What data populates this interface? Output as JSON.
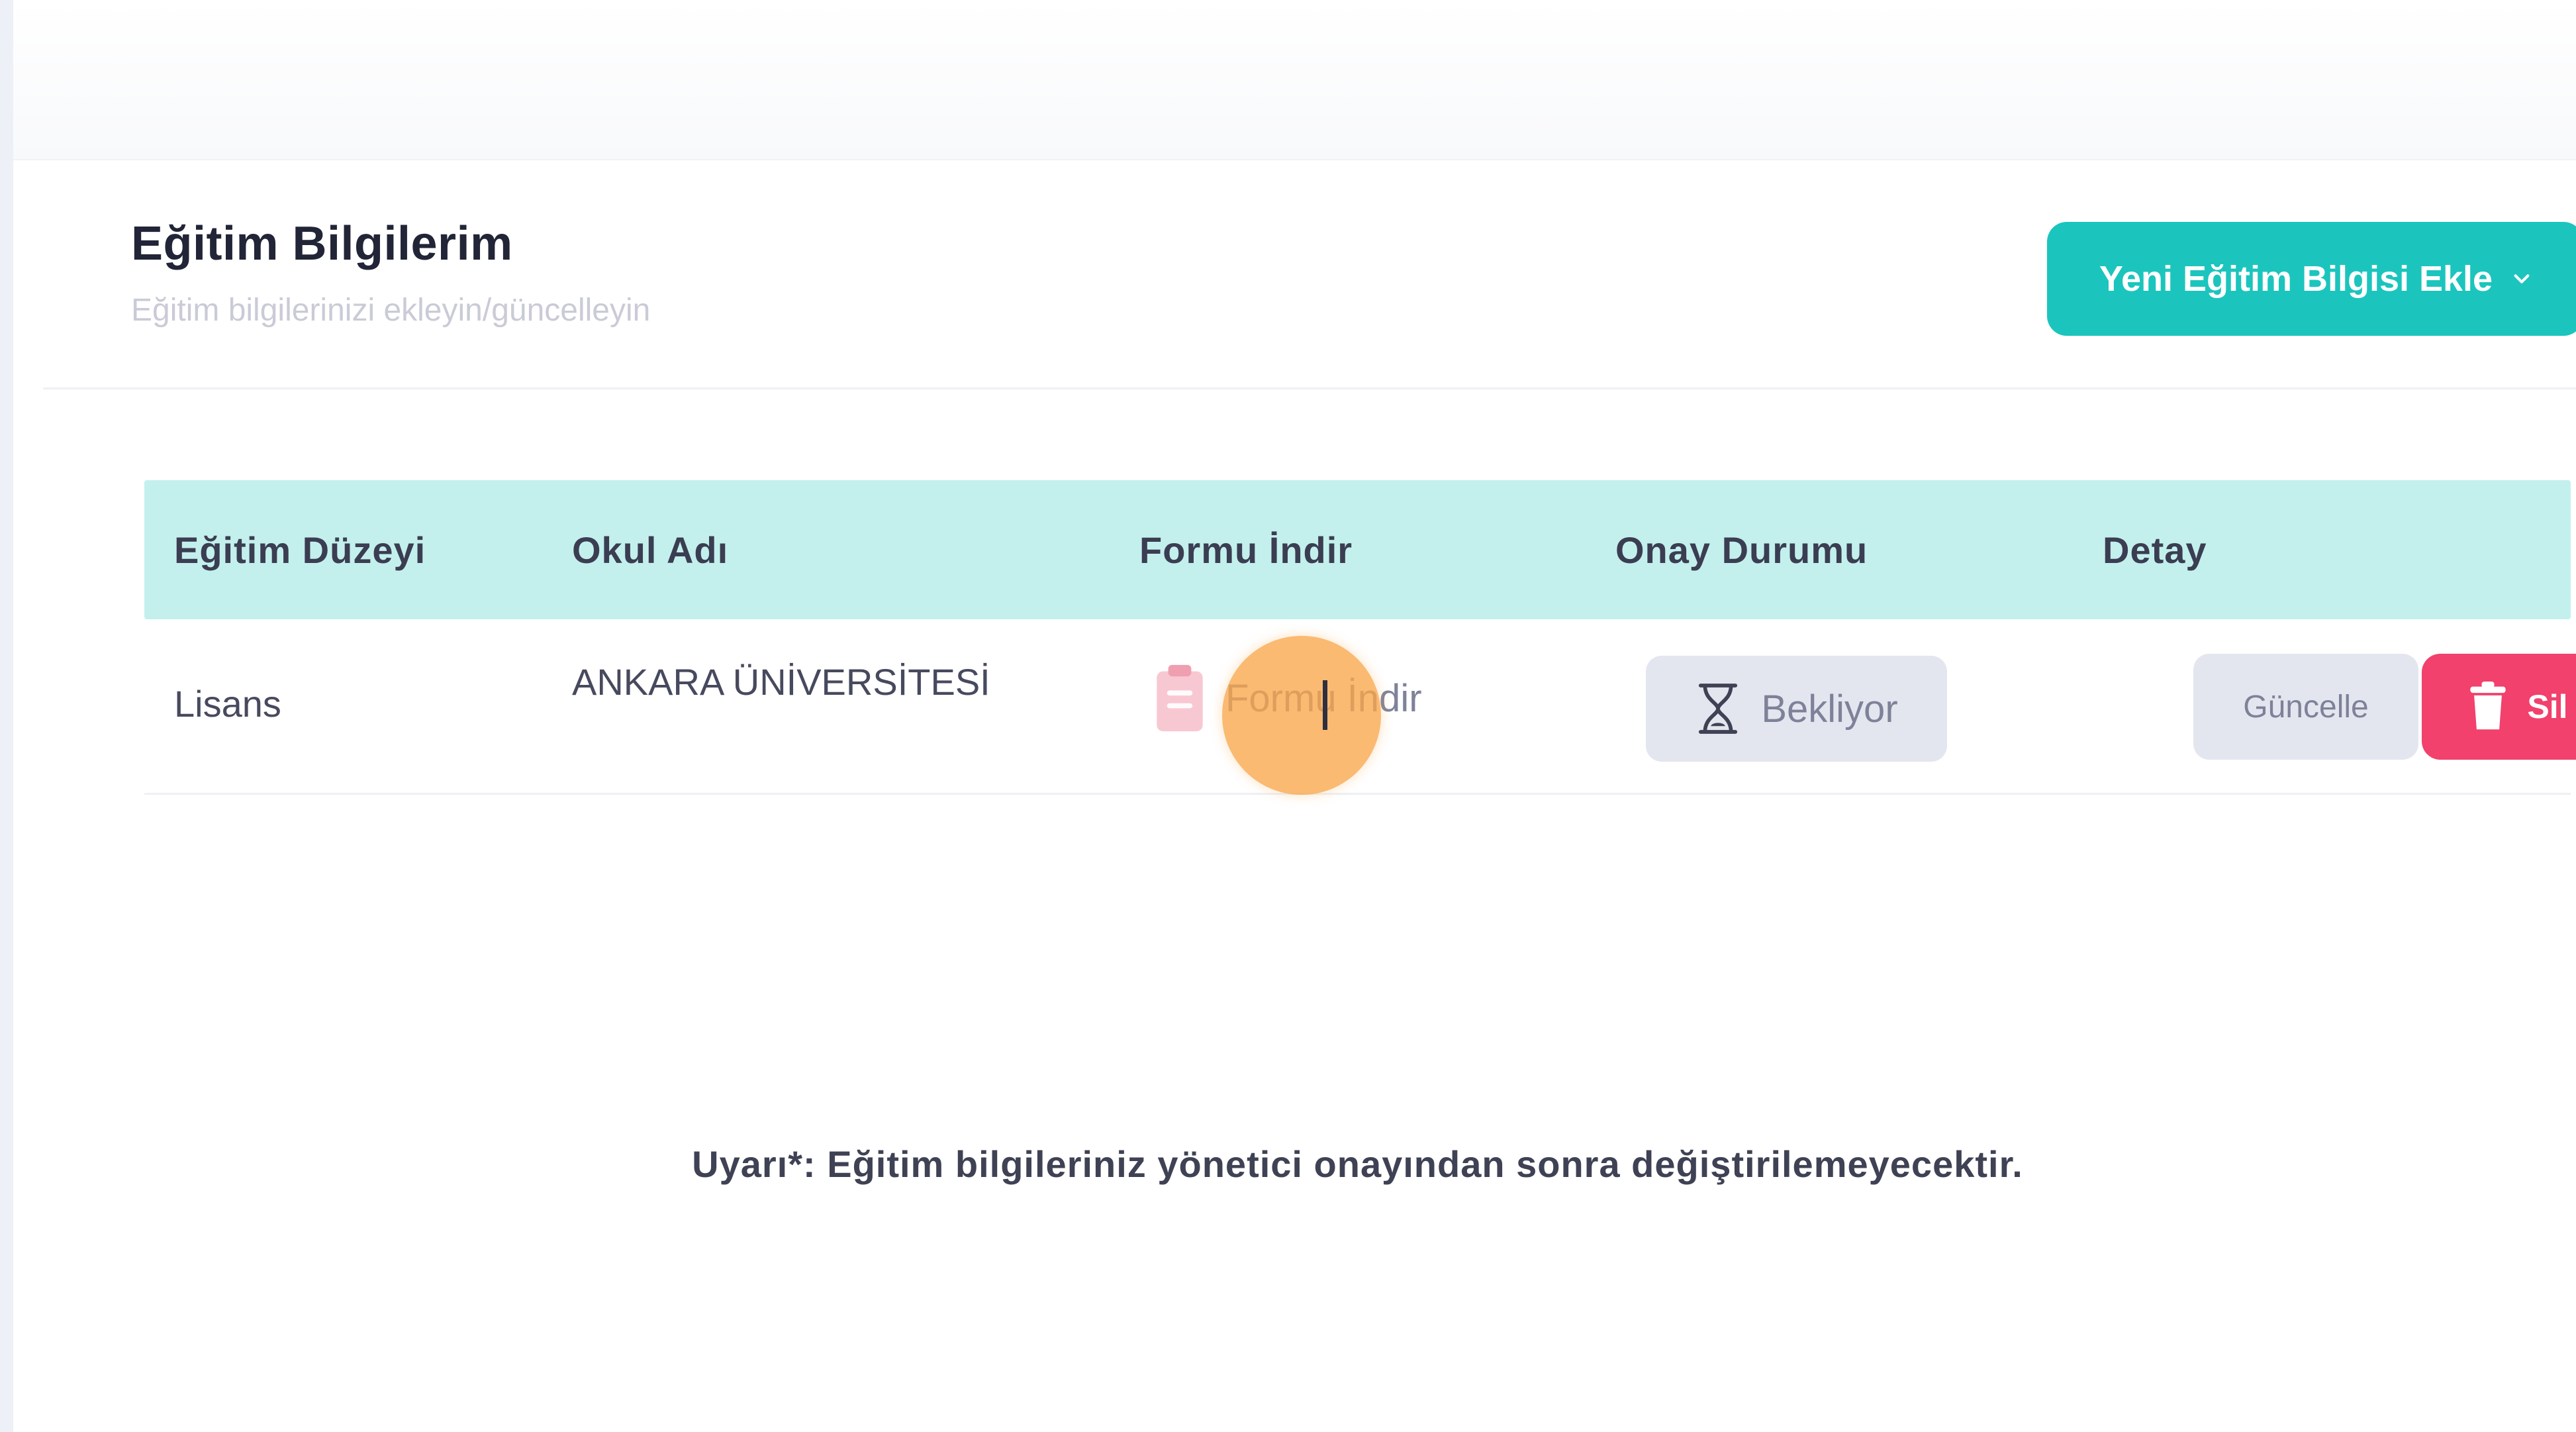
{
  "header": {
    "title": "Eğitim Bilgilerim",
    "subtitle": "Eğitim bilgilerinizi ekleyin/güncelleyin",
    "add_button_label": "Yeni Eğitim Bilgisi Ekle"
  },
  "table": {
    "columns": [
      "Eğitim Düzeyi",
      "Okul Adı",
      "Formu İndir",
      "Onay Durumu",
      "Detay"
    ],
    "rows": [
      {
        "level": "Lisans",
        "school": "ANKARA ÜNİVERSİTESİ",
        "download_label": "Formu İndir",
        "status": "Bekliyor",
        "update_label": "Güncelle",
        "delete_label": "Sil"
      }
    ]
  },
  "warning": "Uyarı*: Eğitim bilgileriniz yönetici onayından sonra değiştirilemeyecektir.",
  "icons": {
    "chevron": "chevron-down-icon",
    "download": "clipboard-icon",
    "status": "hourglass-icon",
    "delete": "trash-icon"
  },
  "colors": {
    "accent": "#1bc5bd",
    "table_header": "#c3f0ec",
    "danger": "#f1416c",
    "status_bg": "#e4e6ef",
    "click_indicator": "#f9a64a"
  }
}
